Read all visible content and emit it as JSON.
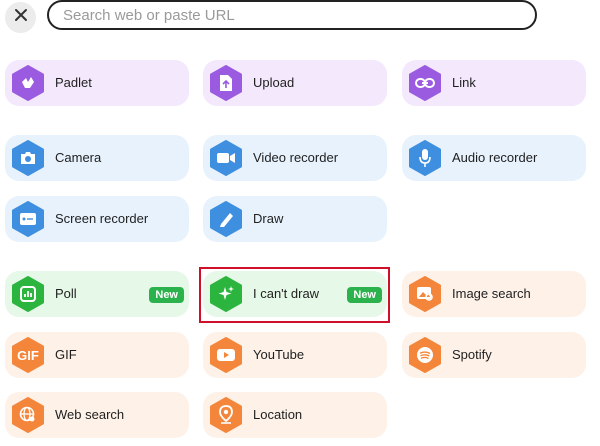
{
  "search": {
    "placeholder": "Search web or paste URL"
  },
  "colors": {
    "purple_tile": "#f3e8fc",
    "purple_icon": "#9b5be0",
    "blue_tile": "#e7f2fd",
    "blue_icon": "#3f8fe0",
    "green_tile": "#e6f8e8",
    "green_icon": "#2cb53e",
    "orange_tile": "#fdf1e8",
    "orange_icon": "#f4863b",
    "badge": "#2bb24c",
    "highlight": "#d0102b"
  },
  "tiles": {
    "padlet": {
      "label": "Padlet",
      "icon": "padlet-bird-icon"
    },
    "upload": {
      "label": "Upload",
      "icon": "upload-icon"
    },
    "link": {
      "label": "Link",
      "icon": "link-icon"
    },
    "camera": {
      "label": "Camera",
      "icon": "camera-icon"
    },
    "video_recorder": {
      "label": "Video recorder",
      "icon": "video-camera-icon"
    },
    "audio_recorder": {
      "label": "Audio recorder",
      "icon": "microphone-icon"
    },
    "screen_recorder": {
      "label": "Screen recorder",
      "icon": "screen-recorder-icon"
    },
    "draw": {
      "label": "Draw",
      "icon": "pencil-icon"
    },
    "poll": {
      "label": "Poll",
      "icon": "poll-icon",
      "badge": "New"
    },
    "cant_draw": {
      "label": "I can't draw",
      "icon": "sparkle-icon",
      "badge": "New"
    },
    "image_search": {
      "label": "Image search",
      "icon": "image-search-icon"
    },
    "gif": {
      "label": "GIF",
      "icon_text": "GIF"
    },
    "youtube": {
      "label": "YouTube",
      "icon": "youtube-icon"
    },
    "spotify": {
      "label": "Spotify",
      "icon": "spotify-icon"
    },
    "web_search": {
      "label": "Web search",
      "icon": "globe-icon"
    },
    "location": {
      "label": "Location",
      "icon": "location-pin-icon"
    }
  }
}
